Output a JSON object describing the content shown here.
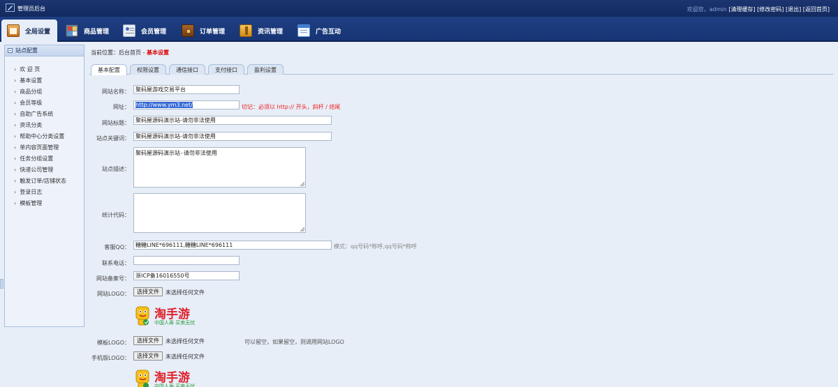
{
  "app": {
    "title": "管理员后台"
  },
  "top_links": {
    "welcome": "欢迎您，admin",
    "clear_cache": "[清理缓存]",
    "change_password": "[修改密码]",
    "logout": "[退出]",
    "home": "[返回首页]"
  },
  "nav": {
    "items": [
      {
        "label": "全局设置",
        "icon": "settings-icon"
      },
      {
        "label": "商品管理",
        "icon": "goods-icon"
      },
      {
        "label": "会员管理",
        "icon": "member-icon"
      },
      {
        "label": "订单管理",
        "icon": "order-icon"
      },
      {
        "label": "资讯管理",
        "icon": "news-icon"
      },
      {
        "label": "广告互动",
        "icon": "ad-icon"
      }
    ]
  },
  "sidebar": {
    "header": "站点配置",
    "items": [
      {
        "label": "欢 迎 页"
      },
      {
        "label": "基本设置"
      },
      {
        "label": "商品分组"
      },
      {
        "label": "会员等级"
      },
      {
        "label": "自助广告系统"
      },
      {
        "label": "资讯分类"
      },
      {
        "label": "帮助中心分类设置"
      },
      {
        "label": "单内容页面管理"
      },
      {
        "label": "任务分组设置"
      },
      {
        "label": "快递公司管理"
      },
      {
        "label": "触发订单/店铺状态"
      },
      {
        "label": "登录日志"
      },
      {
        "label": "模板管理"
      }
    ]
  },
  "breadcrumb": {
    "prefix": "当前位置：后台首页 - ",
    "current": "基本设置"
  },
  "tabs": [
    {
      "label": "基本配置"
    },
    {
      "label": "权限设置"
    },
    {
      "label": "通信接口"
    },
    {
      "label": "支付接口"
    },
    {
      "label": "盈利设置"
    }
  ],
  "form": {
    "site_name": {
      "label": "网站名称：",
      "value": "聚码屋游戏交易平台"
    },
    "url": {
      "label": "网址：",
      "value": "http://www.ym3.net/",
      "hint": "切记：必须以 http:// 开头，斜杆 / 结尾"
    },
    "site_title": {
      "label": "网站标题：",
      "value": "聚码屋源码演示站-请勿非法使用"
    },
    "keywords": {
      "label": "站点关键词：",
      "value": "聚码屋源码演示站-请勿非法使用"
    },
    "description": {
      "label": "站点描述：",
      "value": "聚码屋源码演示站-请勿非法使用"
    },
    "stats_code": {
      "label": "统计代码：",
      "value": ""
    },
    "qq": {
      "label": "客服QQ：",
      "value": "糖糖LINE*696111,糖糖LINE*696111",
      "hint": "模式：qq号码*称呼,qq号码*称呼"
    },
    "phone": {
      "label": "联系电话：",
      "value": ""
    },
    "icp": {
      "label": "网站备案号：",
      "value": "浙ICP备16016550号"
    },
    "site_logo": {
      "label": "网站LOGO：",
      "button": "选择文件",
      "status": "未选择任何文件"
    },
    "template_logo": {
      "label": "模板LOGO：",
      "button": "选择文件",
      "status": "未选择任何文件",
      "hint": "可以留空，如果留空，则调用网站LOGO"
    },
    "mobile_logo": {
      "label": "手机版LOGO：",
      "button": "选择文件",
      "status": "未选择任何文件"
    }
  },
  "logo": {
    "brand": "淘手游",
    "tagline": "中国人寿 买卖无忧"
  },
  "colors": {
    "topbar": "#122a5f",
    "navbar": "#1f3f83",
    "page_bg": "#e7eef8",
    "breadcrumb_current": "#dd0000",
    "hint_red": "#ee2222",
    "brand_red": "#e0202a",
    "tagline_green": "#2a9a3a"
  }
}
